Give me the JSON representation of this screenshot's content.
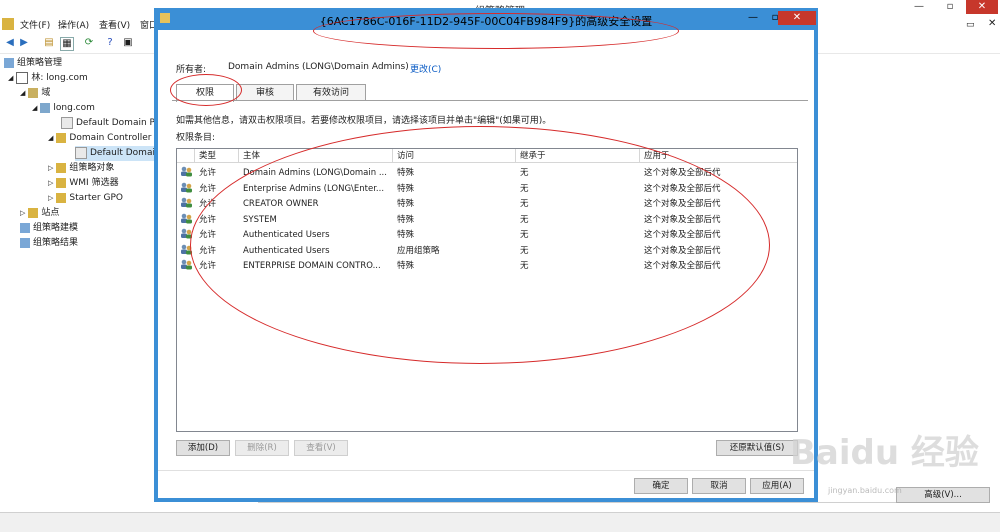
{
  "app": {
    "title": "组策略管理"
  },
  "menu": [
    "文件(F)",
    "操作(A)",
    "查看(V)",
    "窗口"
  ],
  "tree": {
    "root": "组策略管理",
    "items": [
      {
        "label": "林: long.com"
      },
      {
        "label": "域"
      },
      {
        "label": "long.com"
      },
      {
        "label": "Default Domain Po"
      },
      {
        "label": "Domain Controller"
      },
      {
        "label": "Default Domain"
      },
      {
        "label": "组策略对象"
      },
      {
        "label": "WMI 筛选器"
      },
      {
        "label": "Starter GPO"
      },
      {
        "label": "站点"
      },
      {
        "label": "组策略建模"
      },
      {
        "label": "组策略结果"
      }
    ]
  },
  "dialog": {
    "title": "{6AC1786C-016F-11D2-945F-00C04FB984F9}的高级安全设置",
    "owner_label": "所有者:",
    "owner_value": "Domain Admins (LONG\\Domain Admins)",
    "change_link": "更改(C)",
    "tabs": [
      "权限",
      "审核",
      "有效访问"
    ],
    "info": "如需其他信息，请双击权限项目。若要修改权限项目，请选择该项目并单击\"编辑\"(如果可用)。",
    "entries_label": "权限条目:",
    "columns": [
      "类型",
      "主体",
      "访问",
      "继承于",
      "应用于"
    ],
    "rows": [
      [
        "允许",
        "Domain Admins (LONG\\Domain ...",
        "特殊",
        "无",
        "这个对象及全部后代"
      ],
      [
        "允许",
        "Enterprise Admins (LONG\\Enter...",
        "特殊",
        "无",
        "这个对象及全部后代"
      ],
      [
        "允许",
        "CREATOR OWNER",
        "特殊",
        "无",
        "这个对象及全部后代"
      ],
      [
        "允许",
        "SYSTEM",
        "特殊",
        "无",
        "这个对象及全部后代"
      ],
      [
        "允许",
        "Authenticated Users",
        "特殊",
        "无",
        "这个对象及全部后代"
      ],
      [
        "允许",
        "Authenticated Users",
        "应用组策略",
        "无",
        "这个对象及全部后代"
      ],
      [
        "允许",
        "ENTERPRISE DOMAIN CONTRO...",
        "特殊",
        "无",
        "这个对象及全部后代"
      ]
    ],
    "buttons": {
      "add": "添加(D)",
      "remove": "删除(R)",
      "view": "查看(V)",
      "restore": "还原默认值(S)",
      "ok": "确定",
      "cancel": "取消",
      "apply": "应用(A)"
    }
  },
  "background_button": "高级(V)...",
  "watermark": {
    "line1": "Bai",
    "line2": "du 经验",
    "line3": "jingyan.baidu.com"
  }
}
